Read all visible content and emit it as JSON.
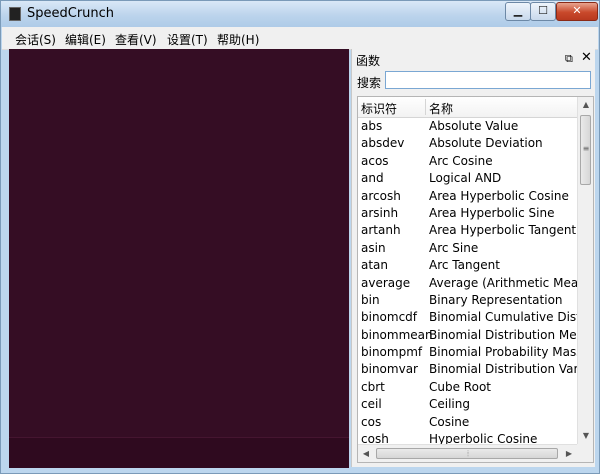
{
  "window": {
    "title": "SpeedCrunch",
    "min": "▁",
    "max": "☐",
    "close": "✕"
  },
  "menu": [
    "会话(S)",
    "编辑(E)",
    "查看(V)",
    "设置(T)",
    "帮助(H)"
  ],
  "panel": {
    "title": "函数",
    "float": "⧉",
    "close": "✕",
    "search_label": "搜索",
    "search_value": "",
    "columns": [
      "标识符",
      "名称"
    ],
    "rows": [
      [
        "abs",
        "Absolute Value"
      ],
      [
        "absdev",
        "Absolute Deviation"
      ],
      [
        "acos",
        "Arc Cosine"
      ],
      [
        "and",
        "Logical AND"
      ],
      [
        "arcosh",
        "Area Hyperbolic Cosine"
      ],
      [
        "arsinh",
        "Area Hyperbolic Sine"
      ],
      [
        "artanh",
        "Area Hyperbolic Tangent"
      ],
      [
        "asin",
        "Arc Sine"
      ],
      [
        "atan",
        "Arc Tangent"
      ],
      [
        "average",
        "Average (Arithmetic Mean)"
      ],
      [
        "bin",
        "Binary Representation"
      ],
      [
        "binomcdf",
        "Binomial Cumulative Distrib"
      ],
      [
        "binommean",
        "Binomial Distribution Mean"
      ],
      [
        "binompmf",
        "Binomial Probability Mass F"
      ],
      [
        "binomvar",
        "Binomial Distribution Varian"
      ],
      [
        "cbrt",
        "Cube Root"
      ],
      [
        "ceil",
        "Ceiling"
      ],
      [
        "cos",
        "Cosine"
      ],
      [
        "cosh",
        "Hyperbolic Cosine"
      ]
    ]
  },
  "icons": {
    "scroll_up": "▲",
    "scroll_down": "▼",
    "scroll_left": "◀",
    "scroll_right": "▶",
    "grip": "≡",
    "hgrip": "⦙"
  },
  "colors": {
    "display_bg": "#350d24",
    "titlebar": "#bcd4ec"
  }
}
